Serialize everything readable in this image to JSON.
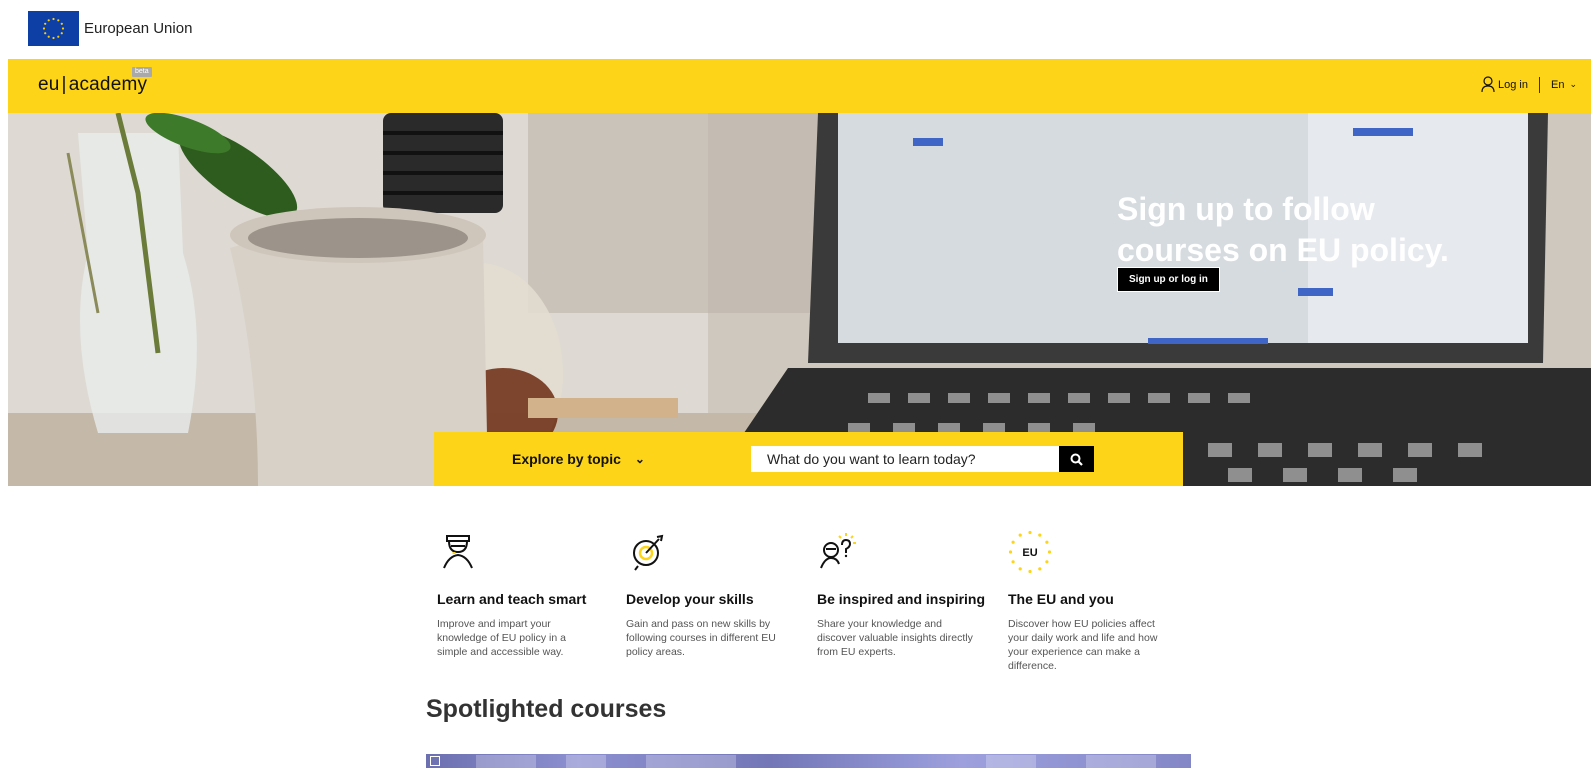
{
  "eu_bar": {
    "label": "European Union"
  },
  "header": {
    "logo_left": "eu",
    "logo_sep": "|",
    "logo_right": "academy",
    "beta": "beta",
    "login": "Log in",
    "language": "En"
  },
  "hero": {
    "title_line1": "Sign up to follow",
    "title_line2": "courses on EU policy.",
    "button": "Sign up or log in"
  },
  "search": {
    "explore_label": "Explore by topic",
    "placeholder": "What do you want to learn today?"
  },
  "features": [
    {
      "icon": "graduate-icon",
      "title": "Learn and teach smart",
      "text": "Improve and impart your knowledge of EU policy in a simple and accessible way."
    },
    {
      "icon": "target-pencil-icon",
      "title": "Develop your skills",
      "text": "Gain and pass on new skills by following courses in different EU policy areas."
    },
    {
      "icon": "inspired-person-icon",
      "title": "Be inspired and inspiring",
      "text": "Share your knowledge and discover valuable insights directly from EU experts."
    },
    {
      "icon": "eu-stars-icon",
      "title": "The EU and you",
      "eu_text": "EU",
      "text": "Discover how EU policies affect your daily work and life and how your experience can make a difference."
    }
  ],
  "spotlight": {
    "title": "Spotlighted courses"
  },
  "colors": {
    "brand_yellow": "#fdd418",
    "eu_blue": "#0e3fa5",
    "star_yellow": "#ffcc00"
  }
}
